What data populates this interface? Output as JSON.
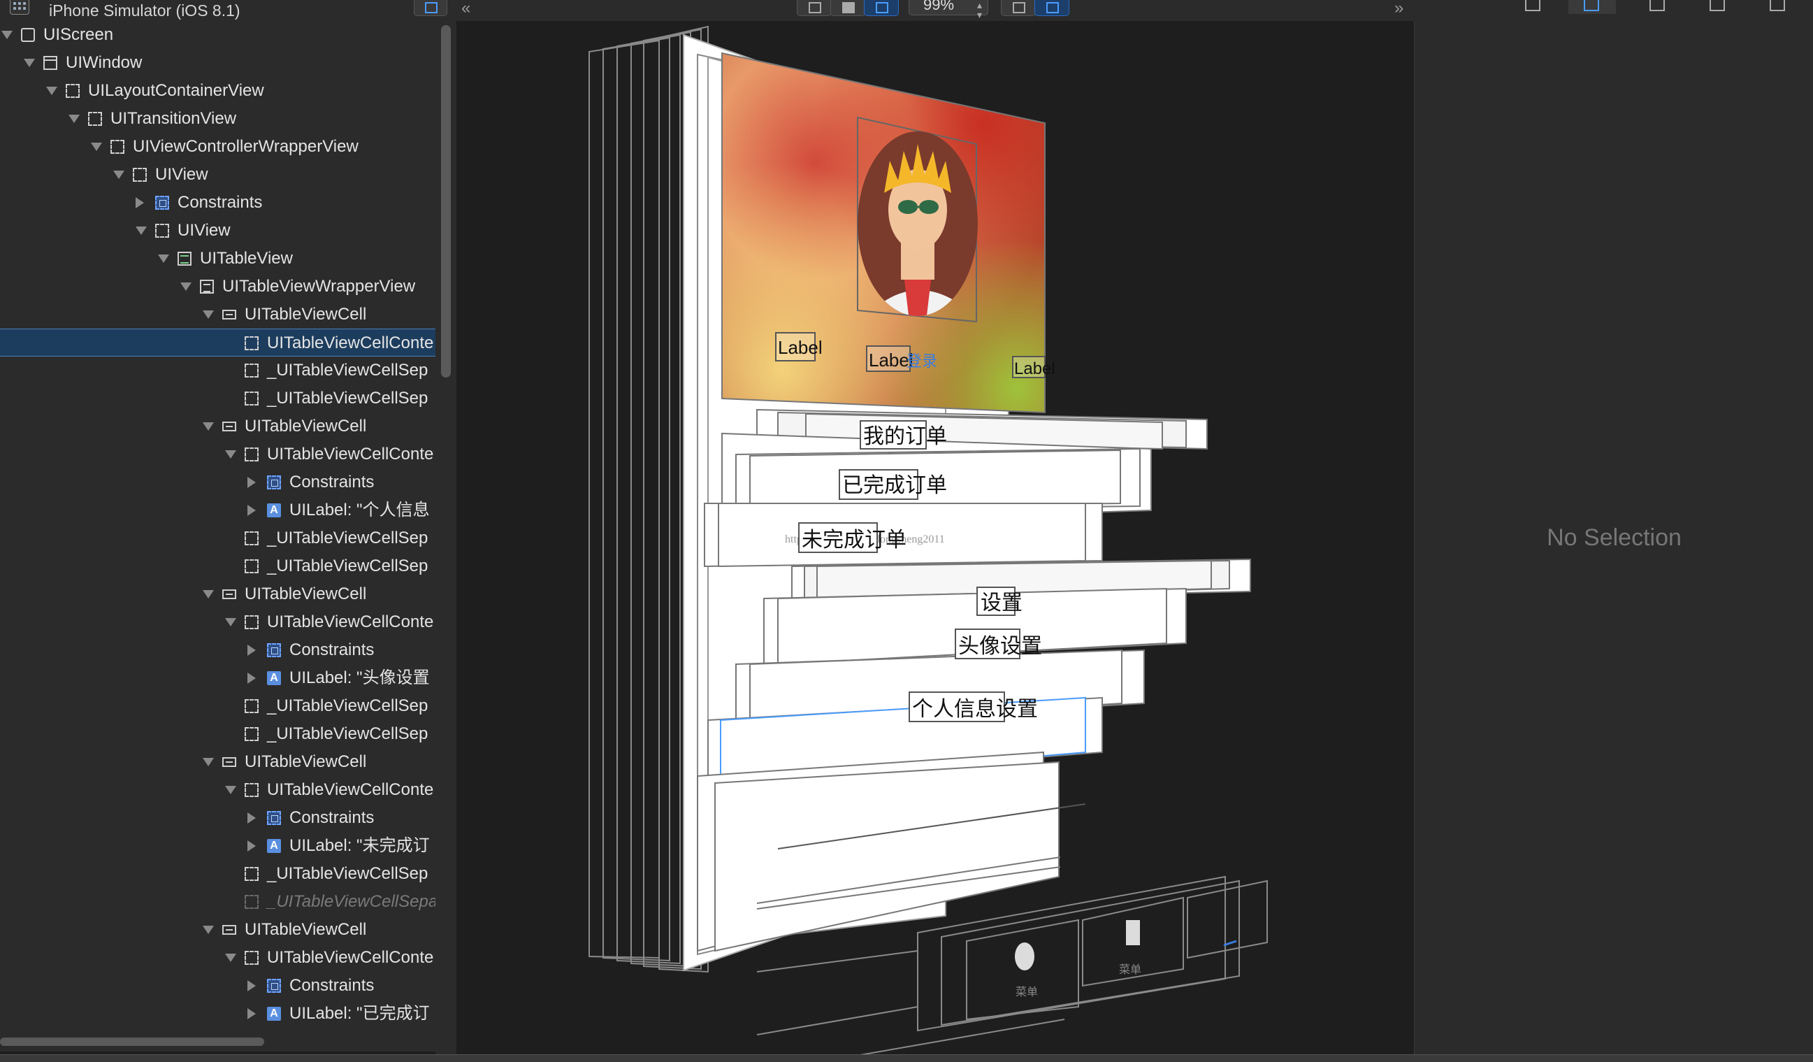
{
  "window": {
    "title": "iPhone Simulator (iOS 8.1)",
    "zoom": "99%",
    "no_selection": "No Selection"
  },
  "tree": [
    {
      "label": "UIScreen",
      "depth": 0,
      "icon": "solid",
      "arrow": "open"
    },
    {
      "label": "UIWindow",
      "depth": 1,
      "icon": "window",
      "arrow": "open"
    },
    {
      "label": "UILayoutContainerView",
      "depth": 2,
      "icon": "dashed",
      "arrow": "open"
    },
    {
      "label": "UITransitionView",
      "depth": 3,
      "icon": "dashed",
      "arrow": "open"
    },
    {
      "label": "UIViewControllerWrapperView",
      "depth": 4,
      "icon": "dashed",
      "arrow": "open"
    },
    {
      "label": "UIView",
      "depth": 5,
      "icon": "dashed",
      "arrow": "open"
    },
    {
      "label": "Constraints",
      "depth": 6,
      "icon": "constraint",
      "arrow": "closed"
    },
    {
      "label": "UIView",
      "depth": 6,
      "icon": "dashed",
      "arrow": "open"
    },
    {
      "label": "UITableView",
      "depth": 7,
      "icon": "table",
      "arrow": "open"
    },
    {
      "label": "UITableViewWrapperView",
      "depth": 8,
      "icon": "tablewrap",
      "arrow": "open"
    },
    {
      "label": "UITableViewCell",
      "depth": 9,
      "icon": "cell",
      "arrow": "open"
    },
    {
      "label": "UITableViewCellConte",
      "depth": 10,
      "icon": "dashed",
      "arrow": "none",
      "selected": true
    },
    {
      "label": "_UITableViewCellSep",
      "depth": 10,
      "icon": "dashed",
      "arrow": "none"
    },
    {
      "label": "_UITableViewCellSep",
      "depth": 10,
      "icon": "dashed",
      "arrow": "none"
    },
    {
      "label": "UITableViewCell",
      "depth": 9,
      "icon": "cell",
      "arrow": "open"
    },
    {
      "label": "UITableViewCellConte",
      "depth": 10,
      "icon": "dashed",
      "arrow": "open"
    },
    {
      "label": "Constraints",
      "depth": 11,
      "icon": "constraint",
      "arrow": "closed"
    },
    {
      "label": "UILabel: \"个人信息",
      "depth": 11,
      "icon": "label",
      "arrow": "closed"
    },
    {
      "label": "_UITableViewCellSep",
      "depth": 10,
      "icon": "dashed",
      "arrow": "none"
    },
    {
      "label": "_UITableViewCellSep",
      "depth": 10,
      "icon": "dashed",
      "arrow": "none"
    },
    {
      "label": "UITableViewCell",
      "depth": 9,
      "icon": "cell",
      "arrow": "open"
    },
    {
      "label": "UITableViewCellConte",
      "depth": 10,
      "icon": "dashed",
      "arrow": "open"
    },
    {
      "label": "Constraints",
      "depth": 11,
      "icon": "constraint",
      "arrow": "closed"
    },
    {
      "label": "UILabel: \"头像设置",
      "depth": 11,
      "icon": "label",
      "arrow": "closed"
    },
    {
      "label": "_UITableViewCellSep",
      "depth": 10,
      "icon": "dashed",
      "arrow": "none"
    },
    {
      "label": "_UITableViewCellSep",
      "depth": 10,
      "icon": "dashed",
      "arrow": "none"
    },
    {
      "label": "UITableViewCell",
      "depth": 9,
      "icon": "cell",
      "arrow": "open"
    },
    {
      "label": "UITableViewCellConte",
      "depth": 10,
      "icon": "dashed",
      "arrow": "open"
    },
    {
      "label": "Constraints",
      "depth": 11,
      "icon": "constraint",
      "arrow": "closed"
    },
    {
      "label": "UILabel: \"未完成订",
      "depth": 11,
      "icon": "label",
      "arrow": "closed"
    },
    {
      "label": "_UITableViewCellSep",
      "depth": 10,
      "icon": "dashed",
      "arrow": "none"
    },
    {
      "label": "_UITableViewCellSepa",
      "depth": 10,
      "icon": "dashed",
      "arrow": "none",
      "dim": true
    },
    {
      "label": "UITableViewCell",
      "depth": 9,
      "icon": "cell",
      "arrow": "open"
    },
    {
      "label": "UITableViewCellConte",
      "depth": 10,
      "icon": "dashed",
      "arrow": "open"
    },
    {
      "label": "Constraints",
      "depth": 11,
      "icon": "constraint",
      "arrow": "closed"
    },
    {
      "label": "UILabel: \"已完成订",
      "depth": 11,
      "icon": "label",
      "arrow": "closed"
    }
  ],
  "scene": {
    "header_labels": [
      "Label",
      "Label",
      "Label"
    ],
    "login_text": "登录",
    "cells": [
      "我的订单",
      "已完成订单",
      "未完成订单",
      "设置",
      "头像设置",
      "个人信息设置"
    ],
    "watermark": "http://blog.csdn.net/dongsheng2011",
    "tab_labels": [
      "菜单",
      "菜单"
    ]
  }
}
